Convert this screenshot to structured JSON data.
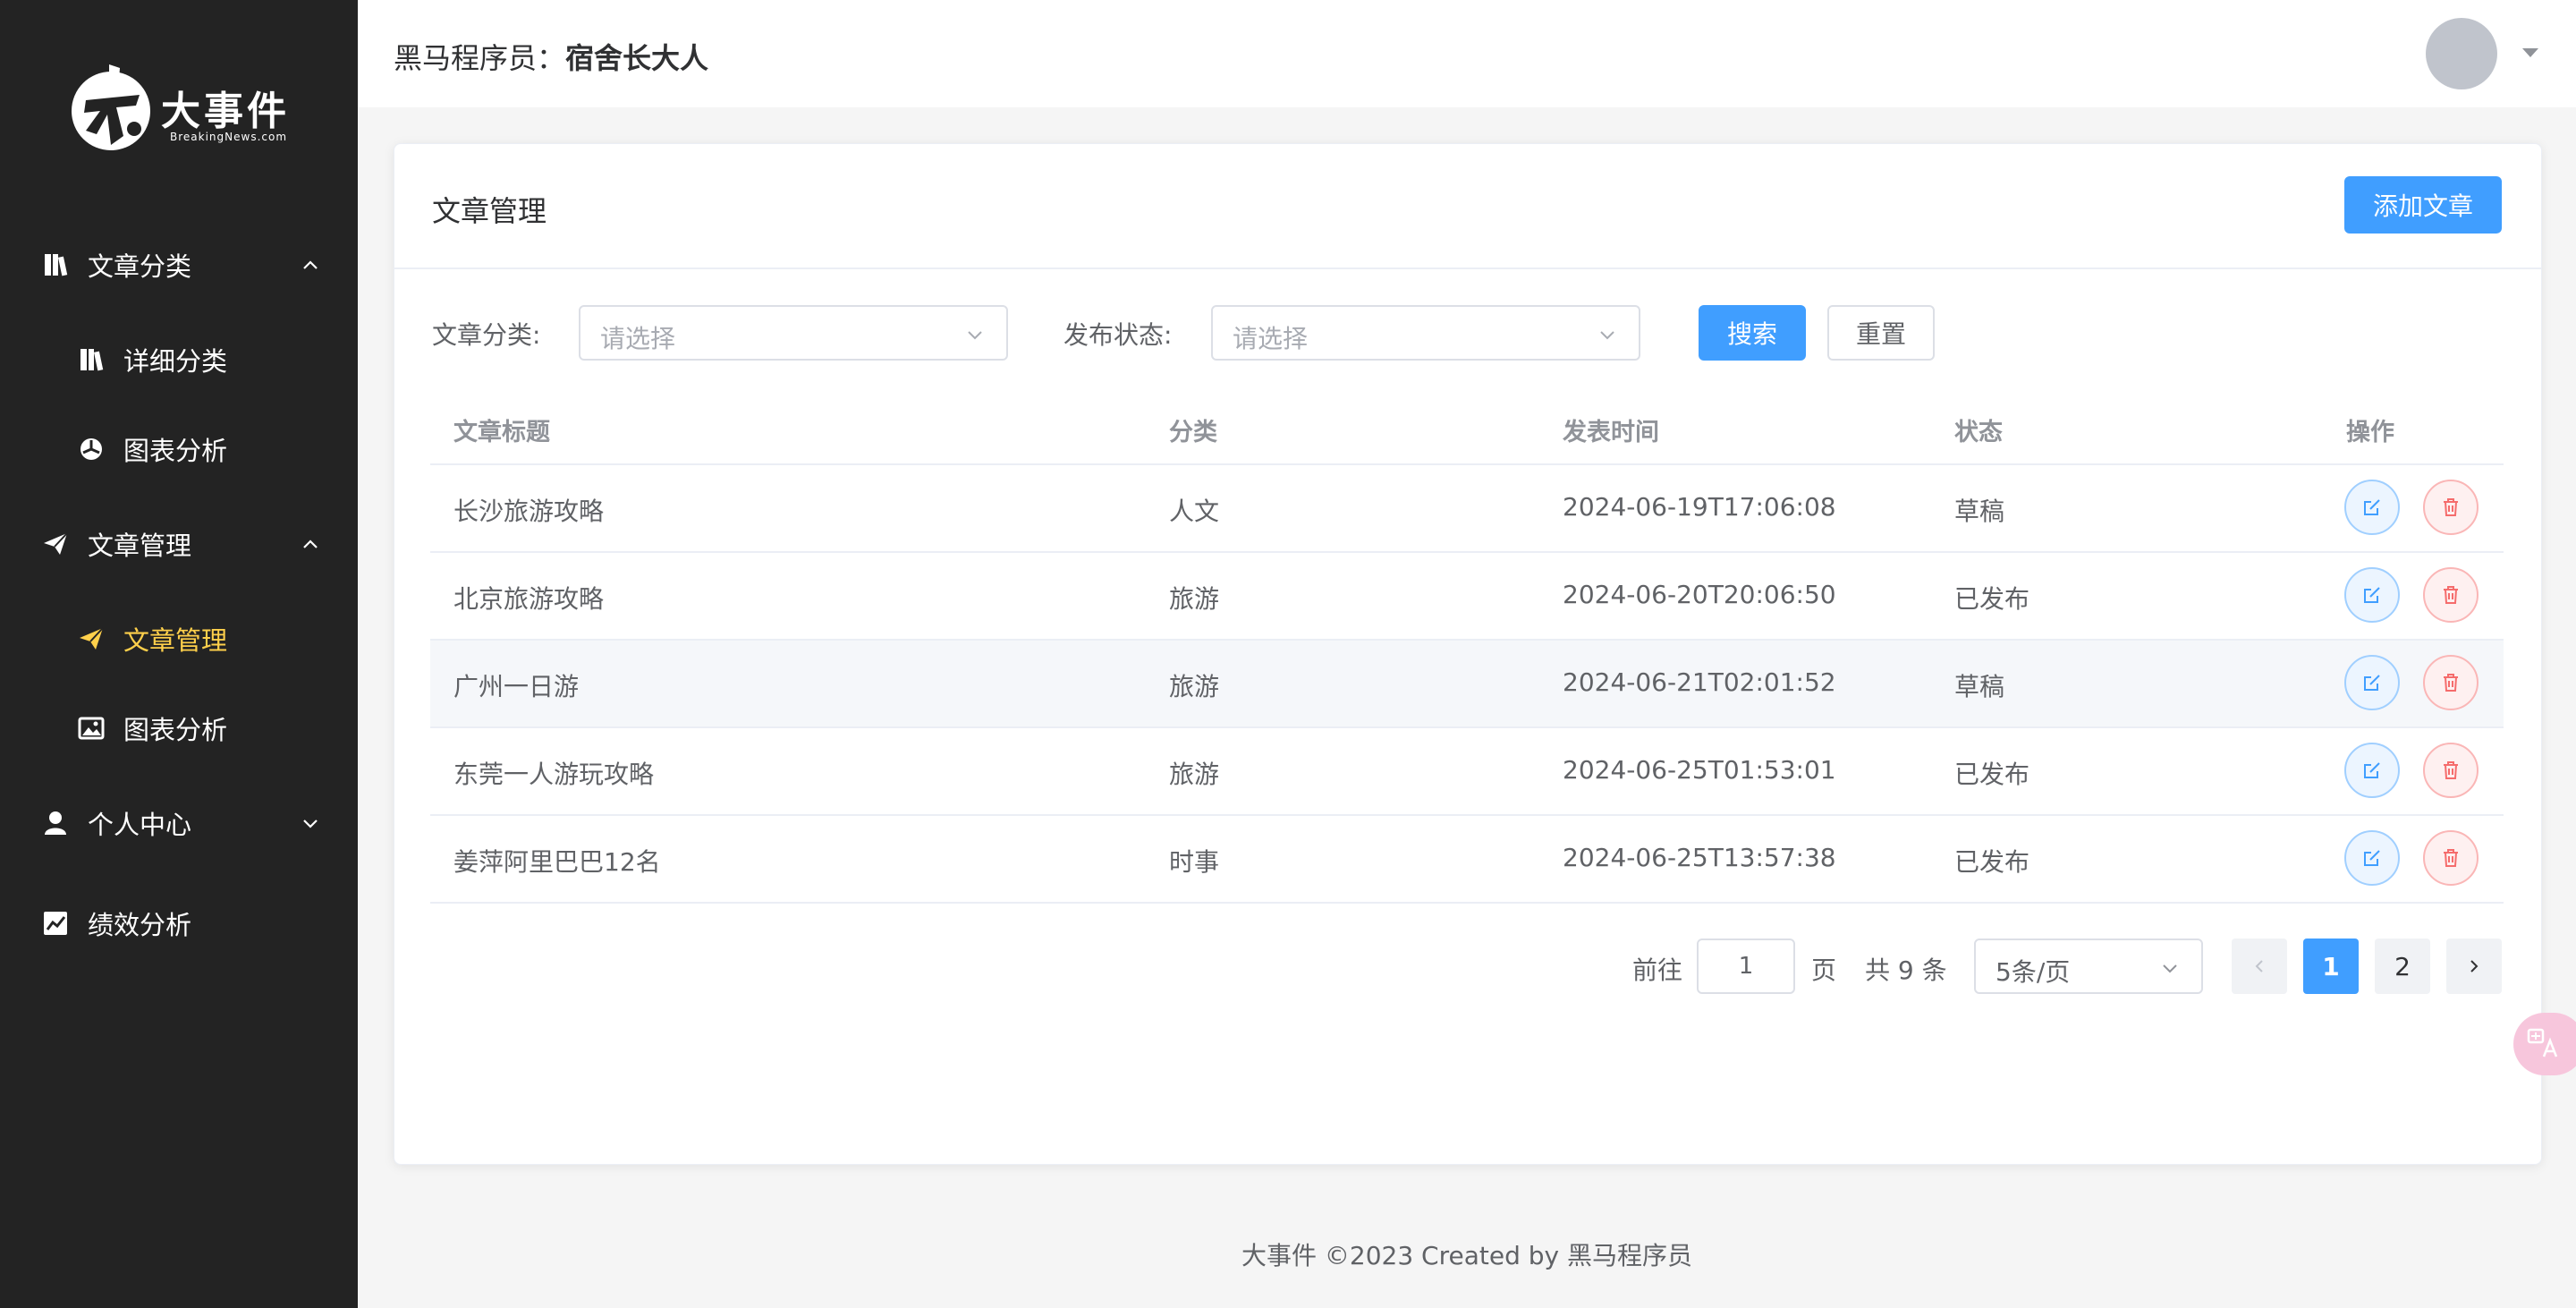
{
  "brand": {
    "name": "大事件",
    "sub": "BreakingNews.com"
  },
  "header": {
    "prefix": "黑马程序员：",
    "username": "宿舍长大人"
  },
  "sidebar": {
    "items": [
      {
        "label": "文章分类",
        "icon": "book-icon"
      },
      {
        "label": "详细分类",
        "icon": "book-icon"
      },
      {
        "label": "图表分析",
        "icon": "pie-chart-icon"
      },
      {
        "label": "文章管理",
        "icon": "paper-plane-icon"
      },
      {
        "label": "文章管理",
        "icon": "paper-plane-icon",
        "active": true
      },
      {
        "label": "图表分析",
        "icon": "image-icon"
      },
      {
        "label": "个人中心",
        "icon": "user-icon"
      },
      {
        "label": "绩效分析",
        "icon": "line-chart-icon"
      }
    ]
  },
  "card": {
    "title": "文章管理",
    "add_label": "添加文章"
  },
  "filter": {
    "category_label": "文章分类:",
    "category_placeholder": "请选择",
    "state_label": "发布状态:",
    "state_placeholder": "请选择",
    "search_label": "搜索",
    "reset_label": "重置"
  },
  "table": {
    "headers": [
      "文章标题",
      "分类",
      "发表时间",
      "状态",
      "操作"
    ],
    "rows": [
      {
        "title": "长沙旅游攻略",
        "category": "人文",
        "time": "2024-06-19T17:06:08",
        "state": "草稿"
      },
      {
        "title": "北京旅游攻略",
        "category": "旅游",
        "time": "2024-06-20T20:06:50",
        "state": "已发布"
      },
      {
        "title": "广州一日游",
        "category": "旅游",
        "time": "2024-06-21T02:01:52",
        "state": "草稿"
      },
      {
        "title": "东莞一人游玩攻略",
        "category": "旅游",
        "time": "2024-06-25T01:53:01",
        "state": "已发布"
      },
      {
        "title": "姜萍阿里巴巴12名",
        "category": "时事",
        "time": "2024-06-25T13:57:38",
        "state": "已发布"
      }
    ]
  },
  "pagination": {
    "goto_prefix": "前往",
    "goto_value": "1",
    "goto_suffix": "页",
    "total": "共 9 条",
    "page_size": "5条/页",
    "pages": [
      "1",
      "2"
    ],
    "current": "1"
  },
  "footer": {
    "text": "大事件 ©2023 Created by 黑马程序员"
  },
  "colors": {
    "primary": "#409eff",
    "sidebar_bg": "#232323",
    "active_menu": "#ffd04b",
    "danger": "#f56c6c"
  }
}
